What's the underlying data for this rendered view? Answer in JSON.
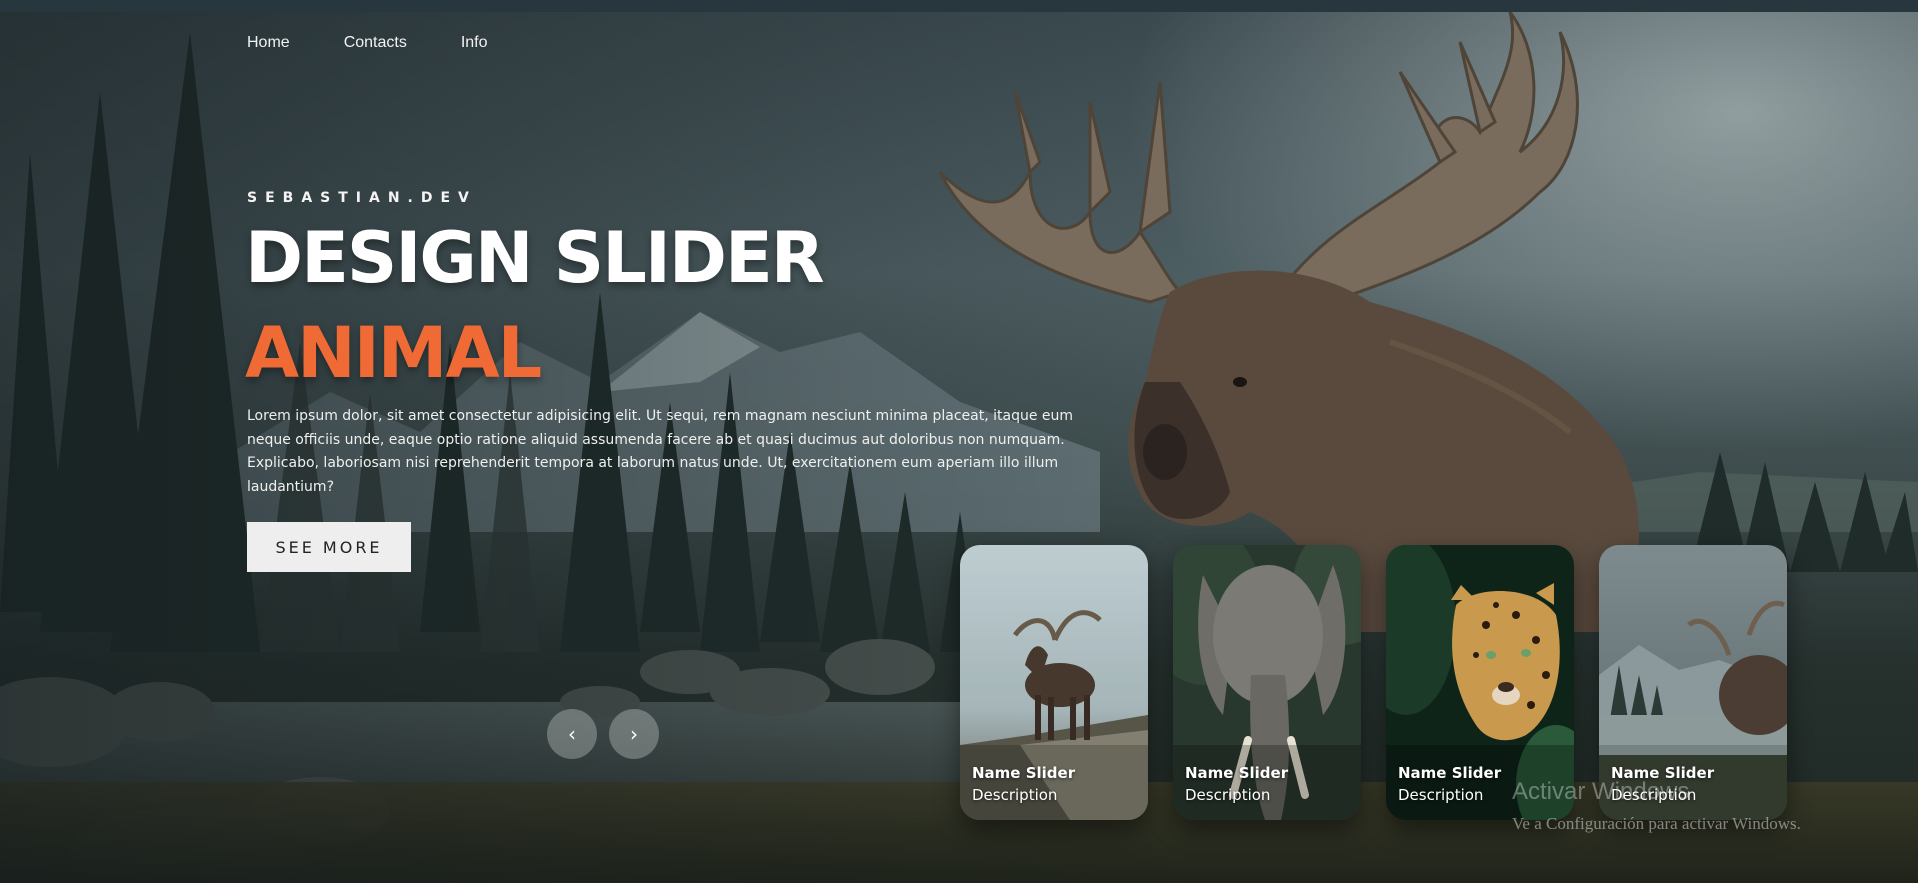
{
  "nav": {
    "items": [
      {
        "label": "Home"
      },
      {
        "label": "Contacts"
      },
      {
        "label": "Info"
      }
    ]
  },
  "hero": {
    "author": "SEBASTIAN.DEV",
    "title": "DESIGN SLIDER",
    "topic": "ANIMAL",
    "description": "Lorem ipsum dolor, sit amet consectetur adipisicing elit. Ut sequi, rem magnam nesciunt minima placeat, itaque eum neque officiis unde, eaque optio ratione aliquid assumenda facere ab et quasi ducimus aut doloribus non numquam. Explicabo, laboriosam nisi reprehenderit tempora at laborum natus unde. Ut, exercitationem eum aperiam illo illum laudantium?",
    "see_more_label": "SEE MORE",
    "accent_color": "#f06a36"
  },
  "arrows": {
    "prev_symbol": "‹",
    "next_symbol": "›"
  },
  "thumbnails": [
    {
      "name": "Name Slider",
      "description": "Description",
      "image": "moose-on-rock"
    },
    {
      "name": "Name Slider",
      "description": "Description",
      "image": "elephant"
    },
    {
      "name": "Name Slider",
      "description": "Description",
      "image": "jaguar"
    },
    {
      "name": "Name Slider",
      "description": "Description",
      "image": "moose-by-lake"
    }
  ],
  "watermark": {
    "title": "Activar Windows",
    "subtitle": "Ve a Configuración para activar Windows."
  }
}
